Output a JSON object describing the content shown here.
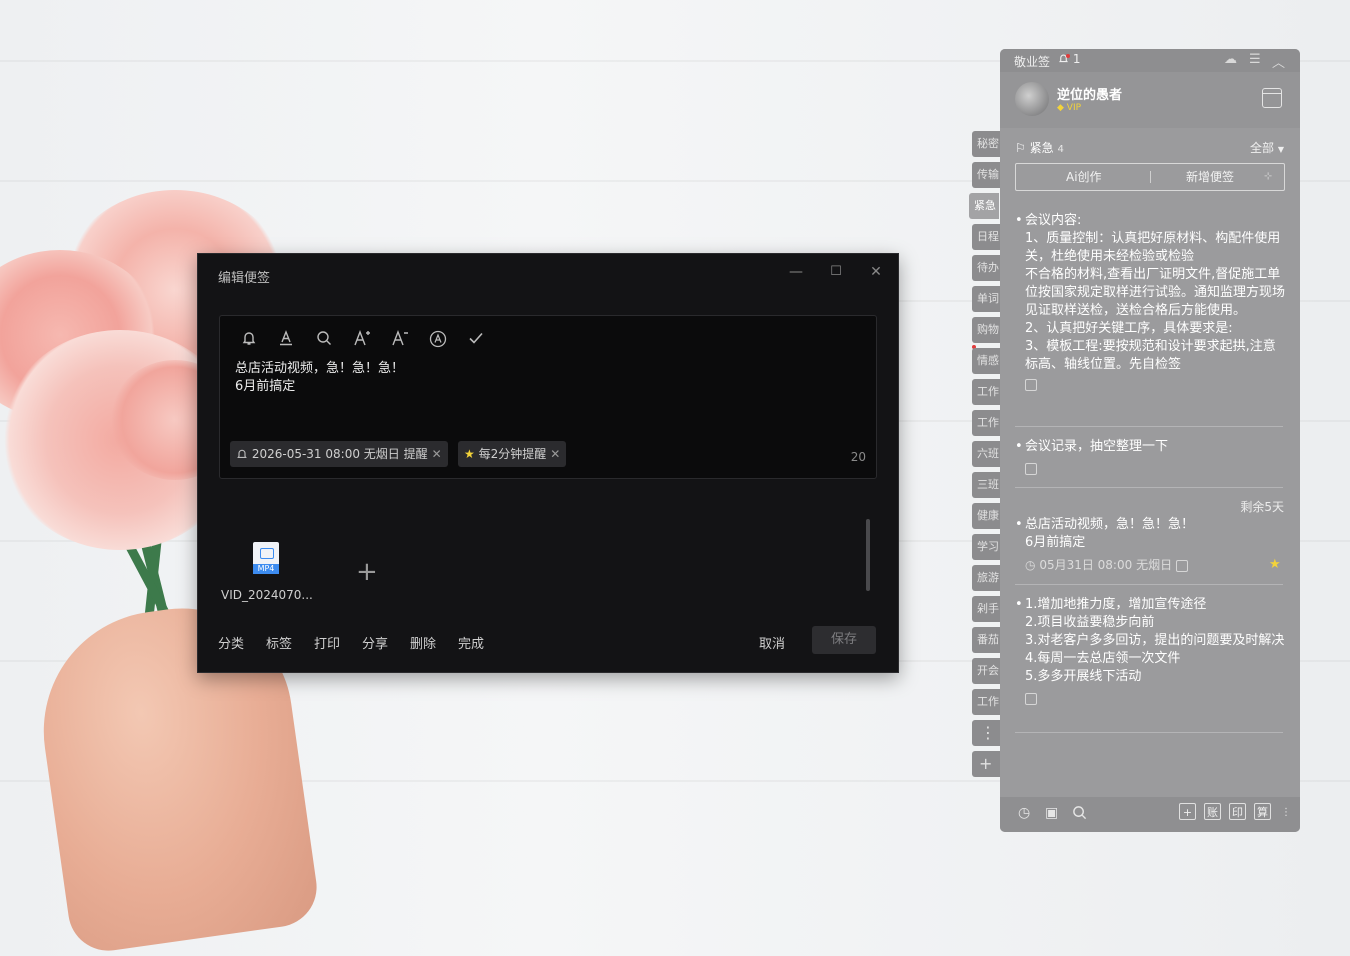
{
  "editor": {
    "title": "编辑便签",
    "minimize": "—",
    "maximize": "☐",
    "close": "✕",
    "toolbar_icons": [
      "bell-icon",
      "text-color-icon",
      "search-icon",
      "font-larger-icon",
      "font-smaller-icon",
      "auto-icon",
      "check-icon"
    ],
    "content": "总店活动视频，急！急！急！\n6月前搞定",
    "reminder_chip": "2026-05-31 08:00 无烟日 提醒",
    "repeat_chip": "每2分钟提醒",
    "char_count": "20",
    "attachment_name": "VID_2024070...",
    "attachment_type": "MP4",
    "add_symbol": "+",
    "bottom_links": [
      "分类",
      "标签",
      "打印",
      "分享",
      "删除",
      "完成"
    ],
    "cancel": "取消",
    "save": "保存"
  },
  "side_tabs": [
    "秘密",
    "传输",
    "紧急",
    "日程",
    "待办",
    "单词",
    "购物",
    "情感",
    "工作",
    "工作",
    "六班",
    "三班",
    "健康",
    "学习",
    "旅游",
    "剁手",
    "番茄",
    "开会",
    "工作"
  ],
  "side_more": "⋮",
  "side_add": "+",
  "panel": {
    "app_name": "敬业签",
    "bell_count": "1",
    "username": "逆位的愚者",
    "vip": "VIP",
    "category": "紧急",
    "category_count": "4",
    "filter": "全部",
    "btn_ai": "Ai创作",
    "btn_new": "新增便签",
    "notes": [
      {
        "text": "会议内容:\n1、质量控制：认真把好原材料、构配件使用关，杜绝使用未经检验或检验\n不合格的材料,查看出厂证明文件,督促施工单位按国家规定取样进行试验。通知监理方现场见证取样送检，送检合格后方能使用。\n2、认真把好关键工序，具体要求是:\n3、模板工程:要按规范和设计要求起拱,注意标高、轴线位置。先自检签"
      },
      {
        "text": "会议记录，抽空整理一下"
      },
      {
        "days_left": "剩余5天",
        "text": "总店活动视频，急！急！急！\n6月前搞定",
        "meta": "05月31日 08:00 无烟日"
      },
      {
        "text": "1.增加地推力度，增加宣传途径\n2.项目收益要稳步向前\n3.对老客户多多回访，提出的问题要及时解决\n4.每周一去总店领一次文件\n5.多多开展线下活动"
      }
    ],
    "bottom_boxes": [
      "+",
      "账",
      "印",
      "算"
    ]
  }
}
